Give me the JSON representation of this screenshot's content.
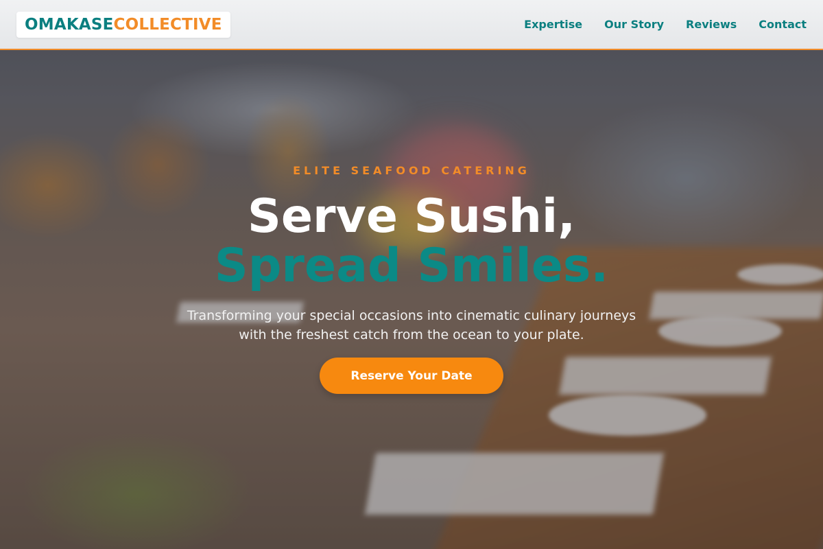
{
  "brand": {
    "part1": "OMAKASE",
    "part2": "COLLECTIVE"
  },
  "nav": {
    "items": [
      {
        "label": "Expertise"
      },
      {
        "label": "Our Story"
      },
      {
        "label": "Reviews"
      },
      {
        "label": "Contact"
      }
    ]
  },
  "hero": {
    "eyebrow": "ELITE SEAFOOD CATERING",
    "headline_line1": "Serve Sushi,",
    "headline_line2": "Spread Smiles.",
    "subtitle": "Transforming your special occasions into cinematic culinary journeys with the freshest catch from the ocean to your plate.",
    "cta_label": "Reserve Your Date"
  },
  "colors": {
    "teal": "#0b7f80",
    "orange": "#f28c28",
    "cta": "#f7890f"
  }
}
